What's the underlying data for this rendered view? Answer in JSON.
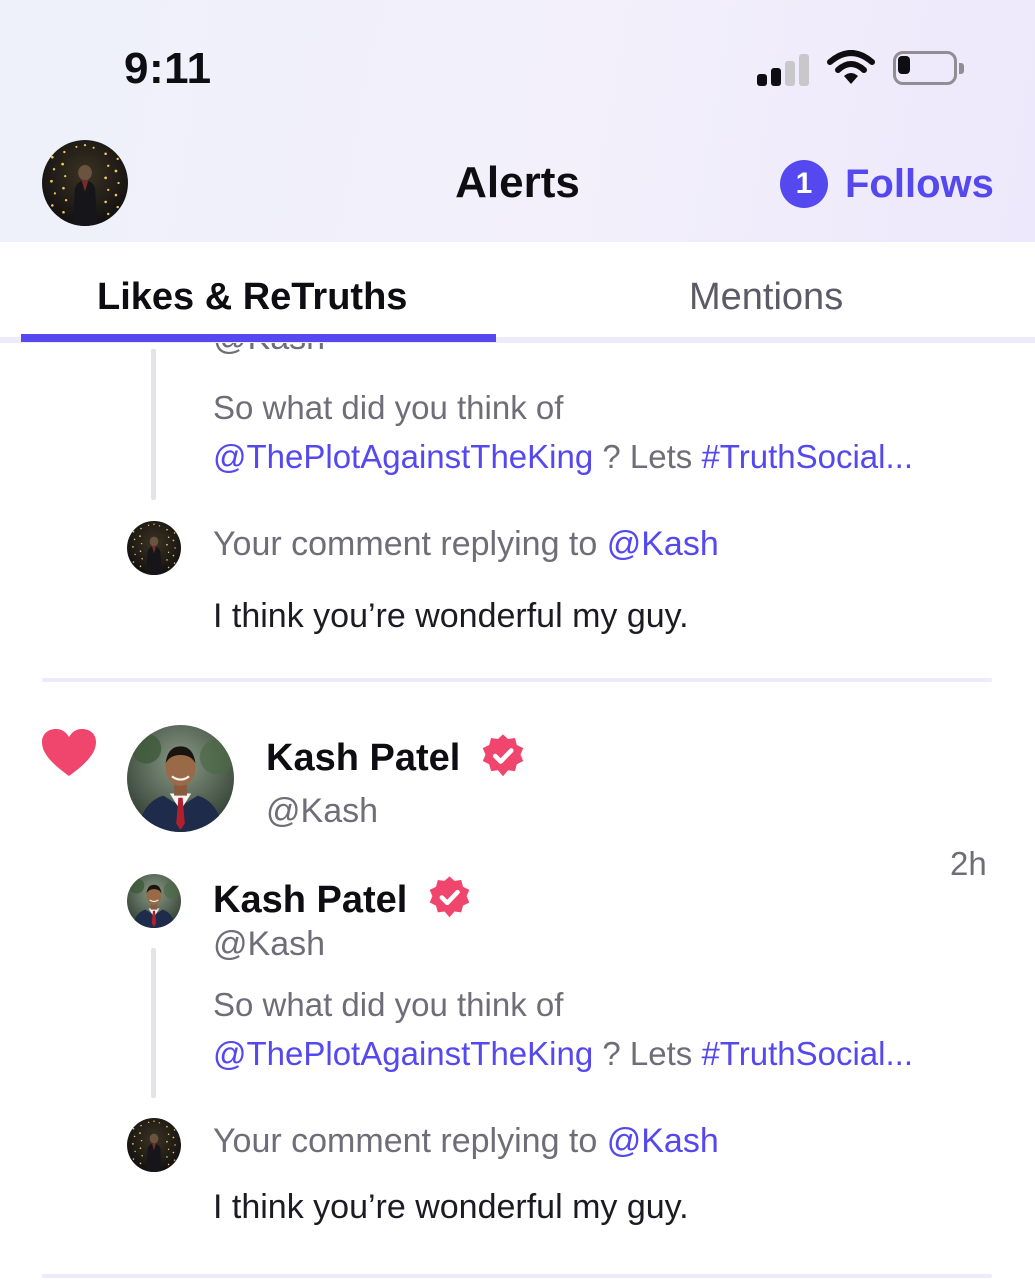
{
  "status_bar": {
    "time": "9:11"
  },
  "header": {
    "title": "Alerts",
    "follows_count": "1",
    "follows_label": "Follows"
  },
  "tabs": [
    {
      "label": "Likes & ReTruths",
      "active": true
    },
    {
      "label": "Mentions",
      "active": false
    }
  ],
  "colors": {
    "accent": "#5448ee",
    "heart": "#f0456c",
    "verified": "#f0456c",
    "muted_text": "#6e6d78"
  },
  "alerts": [
    {
      "partial": true,
      "quoted_post": {
        "handle": "@Kash",
        "text_plain": "So what did you think of",
        "mention": "@ThePlotAgainstTheKing",
        "text_mid": " ? Lets ",
        "hashtag": "#TruthSocial..."
      },
      "reply": {
        "label_prefix": "Your comment replying to ",
        "label_mention": "@Kash",
        "text": "I think you’re wonderful my guy."
      }
    },
    {
      "type_icon": "heart-icon",
      "liker": {
        "name": "Kash Patel",
        "handle": "@Kash",
        "verified": true
      },
      "time": "2h",
      "quoted_post": {
        "author": "Kash Patel",
        "handle": "@Kash",
        "verified": true,
        "text_plain": "So what did you think of",
        "mention": "@ThePlotAgainstTheKing",
        "text_mid": " ? Lets ",
        "hashtag": "#TruthSocial..."
      },
      "reply": {
        "label_prefix": "Your comment replying to ",
        "label_mention": "@Kash",
        "text": "I think you’re wonderful my guy."
      }
    }
  ]
}
